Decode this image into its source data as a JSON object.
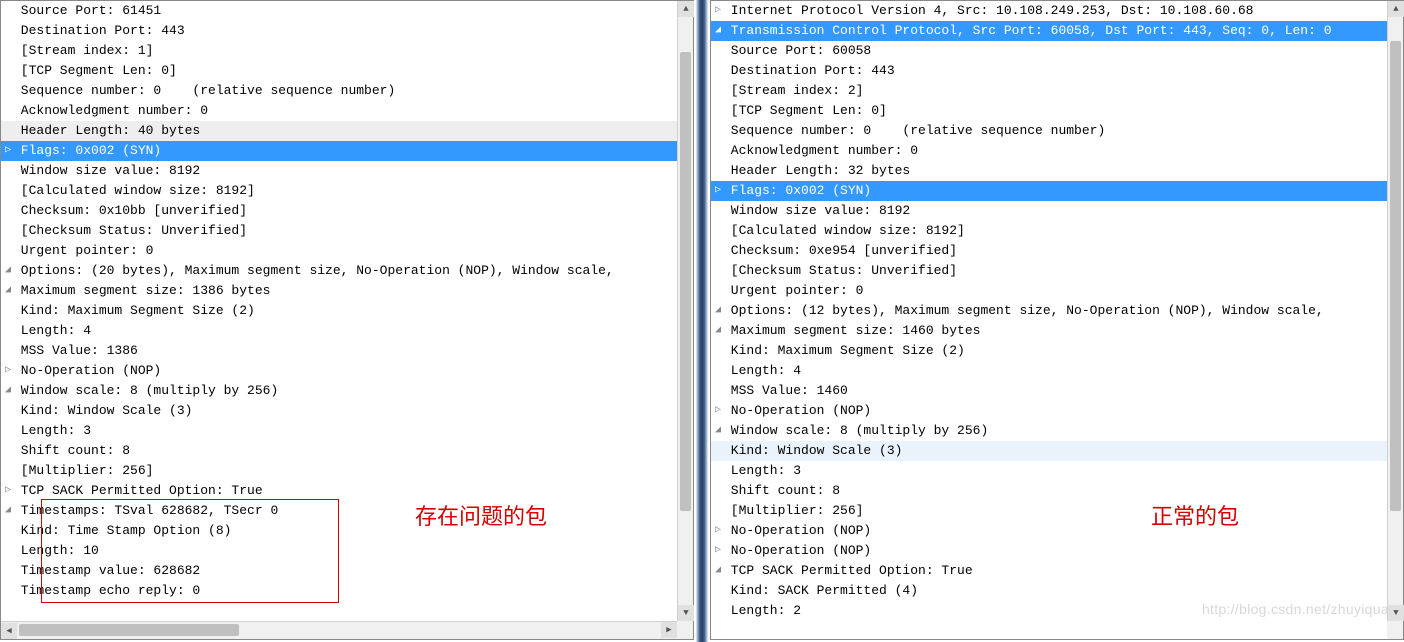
{
  "left": {
    "annotation": "存在问题的包",
    "rows": [
      {
        "indent": 3,
        "tri": "",
        "text": "Source Port: 61451"
      },
      {
        "indent": 3,
        "tri": "",
        "text": "Destination Port: 443"
      },
      {
        "indent": 3,
        "tri": "",
        "text": "[Stream index: 1]"
      },
      {
        "indent": 3,
        "tri": "",
        "text": "[TCP Segment Len: 0]"
      },
      {
        "indent": 3,
        "tri": "",
        "text": "Sequence number: 0    (relative sequence number)"
      },
      {
        "indent": 3,
        "tri": "",
        "text": "Acknowledgment number: 0"
      },
      {
        "indent": 3,
        "tri": "",
        "text": "Header Length: 40 bytes",
        "cls": "hdr"
      },
      {
        "indent": 2,
        "tri": "▷",
        "text": "Flags: 0x002 (SYN)",
        "cls": "sel"
      },
      {
        "indent": 3,
        "tri": "",
        "text": "Window size value: 8192"
      },
      {
        "indent": 3,
        "tri": "",
        "text": "[Calculated window size: 8192]"
      },
      {
        "indent": 3,
        "tri": "",
        "text": "Checksum: 0x10bb [unverified]"
      },
      {
        "indent": 3,
        "tri": "",
        "text": "[Checksum Status: Unverified]"
      },
      {
        "indent": 3,
        "tri": "",
        "text": "Urgent pointer: 0"
      },
      {
        "indent": 2,
        "tri": "◢",
        "text": "Options: (20 bytes), Maximum segment size, No-Operation (NOP), Window scale, "
      },
      {
        "indent": 4,
        "tri": "◢",
        "text": "Maximum segment size: 1386 bytes"
      },
      {
        "indent": 7,
        "tri": "",
        "text": "Kind: Maximum Segment Size (2)"
      },
      {
        "indent": 7,
        "tri": "",
        "text": "Length: 4"
      },
      {
        "indent": 7,
        "tri": "",
        "text": "MSS Value: 1386"
      },
      {
        "indent": 4,
        "tri": "▷",
        "text": "No-Operation (NOP)"
      },
      {
        "indent": 4,
        "tri": "◢",
        "text": "Window scale: 8 (multiply by 256)"
      },
      {
        "indent": 7,
        "tri": "",
        "text": "Kind: Window Scale (3)"
      },
      {
        "indent": 7,
        "tri": "",
        "text": "Length: 3"
      },
      {
        "indent": 7,
        "tri": "",
        "text": "Shift count: 8"
      },
      {
        "indent": 7,
        "tri": "",
        "text": "[Multiplier: 256]"
      },
      {
        "indent": 4,
        "tri": "▷",
        "text": "TCP SACK Permitted Option: True"
      },
      {
        "indent": 4,
        "tri": "◢",
        "text": "Timestamps: TSval 628682, TSecr 0"
      },
      {
        "indent": 7,
        "tri": "",
        "text": "Kind: Time Stamp Option (8)"
      },
      {
        "indent": 7,
        "tri": "",
        "text": "Length: 10"
      },
      {
        "indent": 7,
        "tri": "",
        "text": "Timestamp value: 628682"
      },
      {
        "indent": 7,
        "tri": "",
        "text": "Timestamp echo reply: 0"
      }
    ]
  },
  "right": {
    "annotation": "正常的包",
    "watermark": "http://blog.csdn.net/zhuyiquan",
    "rows": [
      {
        "indent": 0,
        "tri": "▷",
        "text": "Internet Protocol Version 4, Src: 10.108.249.253, Dst: 10.108.60.68"
      },
      {
        "indent": 0,
        "tri": "◢",
        "text": "Transmission Control Protocol, Src Port: 60058, Dst Port: 443, Seq: 0, Len: 0",
        "cls": "sel"
      },
      {
        "indent": 3,
        "tri": "",
        "text": "Source Port: 60058"
      },
      {
        "indent": 3,
        "tri": "",
        "text": "Destination Port: 443"
      },
      {
        "indent": 3,
        "tri": "",
        "text": "[Stream index: 2]"
      },
      {
        "indent": 3,
        "tri": "",
        "text": "[TCP Segment Len: 0]"
      },
      {
        "indent": 3,
        "tri": "",
        "text": "Sequence number: 0    (relative sequence number)"
      },
      {
        "indent": 3,
        "tri": "",
        "text": "Acknowledgment number: 0"
      },
      {
        "indent": 3,
        "tri": "",
        "text": "Header Length: 32 bytes"
      },
      {
        "indent": 2,
        "tri": "▷",
        "text": "Flags: 0x002 (SYN)",
        "cls": "sel"
      },
      {
        "indent": 3,
        "tri": "",
        "text": "Window size value: 8192"
      },
      {
        "indent": 3,
        "tri": "",
        "text": "[Calculated window size: 8192]"
      },
      {
        "indent": 3,
        "tri": "",
        "text": "Checksum: 0xe954 [unverified]"
      },
      {
        "indent": 3,
        "tri": "",
        "text": "[Checksum Status: Unverified]"
      },
      {
        "indent": 3,
        "tri": "",
        "text": "Urgent pointer: 0"
      },
      {
        "indent": 2,
        "tri": "◢",
        "text": "Options: (12 bytes), Maximum segment size, No-Operation (NOP), Window scale, "
      },
      {
        "indent": 4,
        "tri": "◢",
        "text": "Maximum segment size: 1460 bytes"
      },
      {
        "indent": 7,
        "tri": "",
        "text": "Kind: Maximum Segment Size (2)"
      },
      {
        "indent": 7,
        "tri": "",
        "text": "Length: 4"
      },
      {
        "indent": 7,
        "tri": "",
        "text": "MSS Value: 1460"
      },
      {
        "indent": 4,
        "tri": "▷",
        "text": "No-Operation (NOP)"
      },
      {
        "indent": 4,
        "tri": "◢",
        "text": "Window scale: 8 (multiply by 256)"
      },
      {
        "indent": 7,
        "tri": "",
        "text": "Kind: Window Scale (3)",
        "cls": "hov"
      },
      {
        "indent": 7,
        "tri": "",
        "text": "Length: 3"
      },
      {
        "indent": 7,
        "tri": "",
        "text": "Shift count: 8"
      },
      {
        "indent": 7,
        "tri": "",
        "text": "[Multiplier: 256]"
      },
      {
        "indent": 4,
        "tri": "▷",
        "text": "No-Operation (NOP)"
      },
      {
        "indent": 4,
        "tri": "▷",
        "text": "No-Operation (NOP)"
      },
      {
        "indent": 4,
        "tri": "◢",
        "text": "TCP SACK Permitted Option: True"
      },
      {
        "indent": 7,
        "tri": "",
        "text": "Kind: SACK Permitted (4)"
      },
      {
        "indent": 7,
        "tri": "",
        "text": "Length: 2"
      }
    ]
  }
}
